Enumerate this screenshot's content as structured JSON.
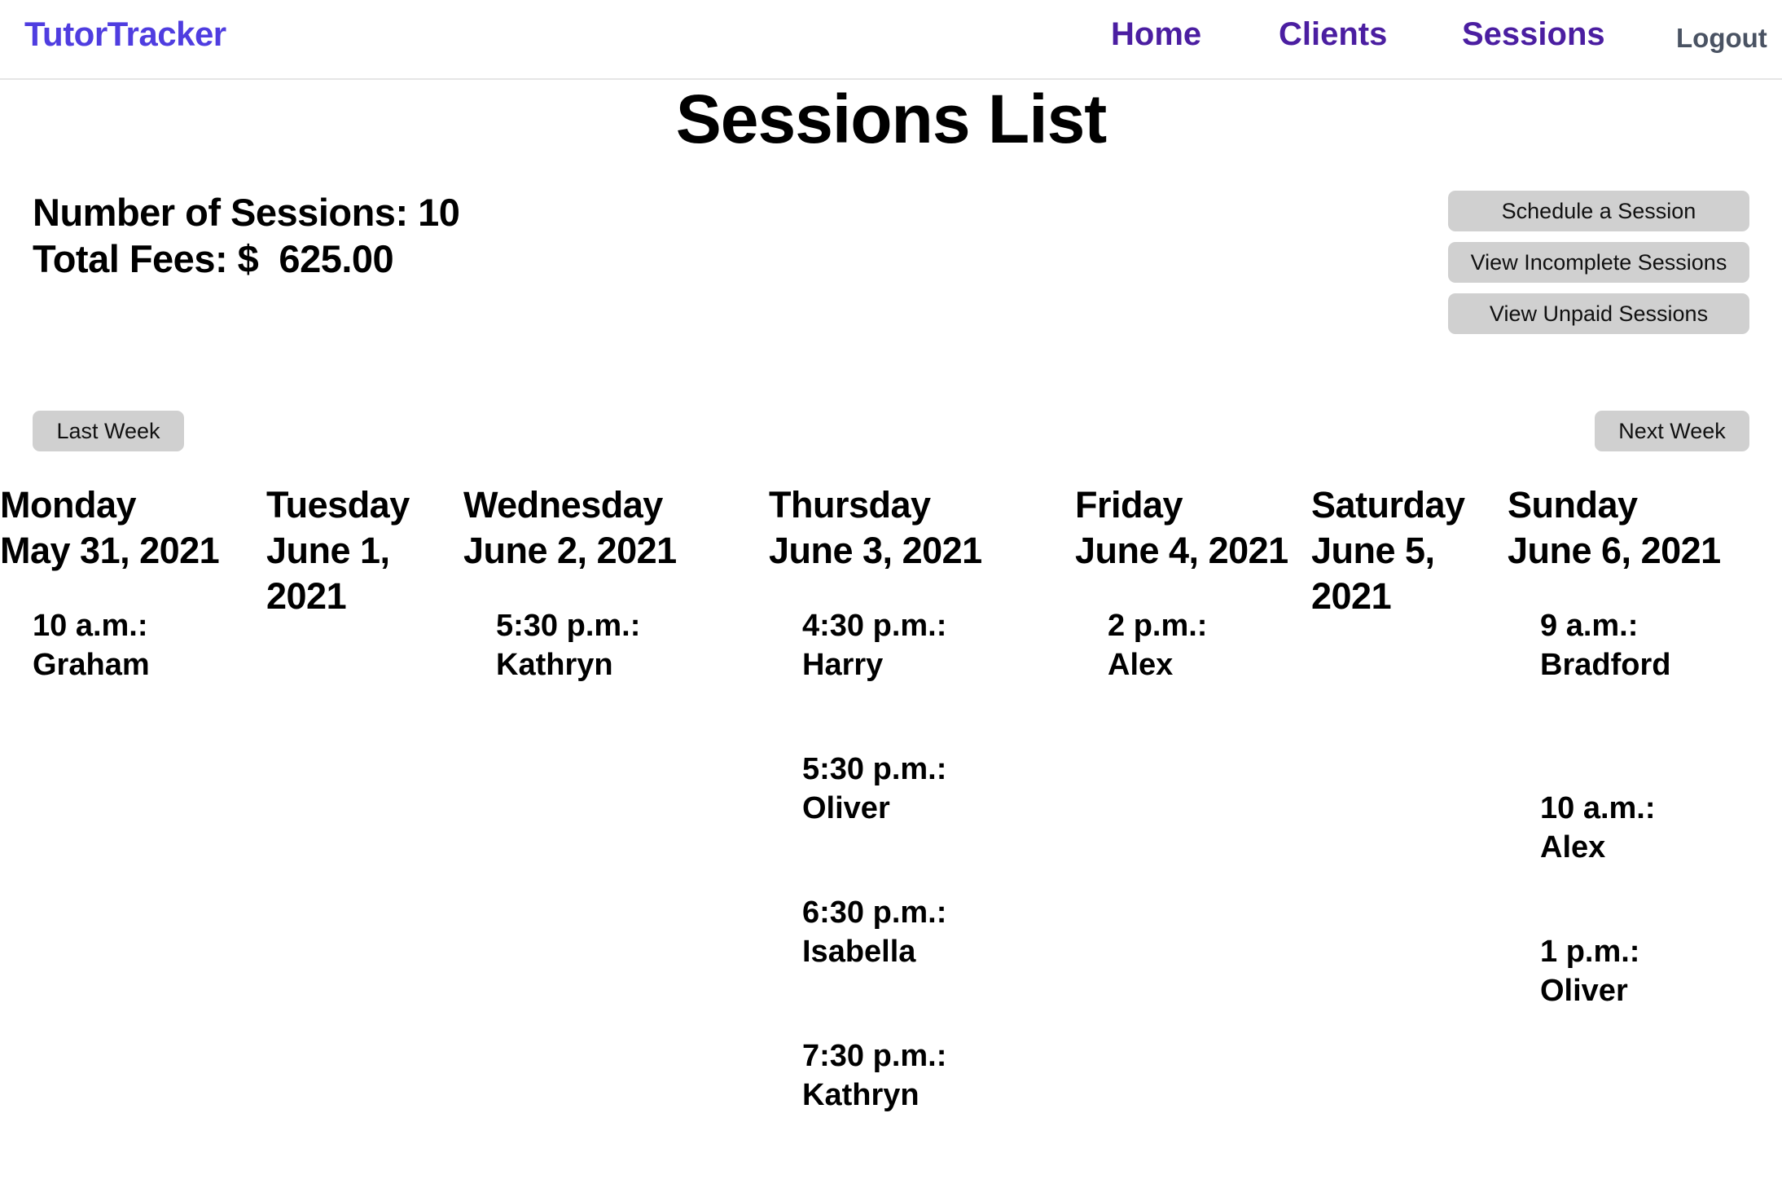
{
  "nav": {
    "brand": "TutorTracker",
    "home": "Home",
    "clients": "Clients",
    "sessions": "Sessions",
    "logout": "Logout"
  },
  "title": "Sessions List",
  "summary": {
    "count_line": "Number of Sessions: 10",
    "fees_line": "Total Fees: $  625.00"
  },
  "actions": {
    "schedule": "Schedule a Session",
    "incomplete": "View Incomplete Sessions",
    "unpaid": "View Unpaid Sessions"
  },
  "week_nav": {
    "last": "Last Week",
    "next": "Next Week"
  },
  "days": [
    {
      "name": "Monday",
      "date": "May 31, 2021",
      "sessions": [
        {
          "time": "10 a.m.:",
          "client": "Graham"
        }
      ]
    },
    {
      "name": "Tuesday",
      "date": "June 1, 2021",
      "sessions": []
    },
    {
      "name": "Wednesday",
      "date": "June 2, 2021",
      "sessions": [
        {
          "time": "5:30 p.m.:",
          "client": "Kathryn"
        }
      ]
    },
    {
      "name": "Thursday",
      "date": "June 3, 2021",
      "sessions": [
        {
          "time": "4:30 p.m.:",
          "client": "Harry"
        },
        {
          "time": "5:30 p.m.:",
          "client": "Oliver"
        },
        {
          "time": "6:30 p.m.:",
          "client": "Isabella"
        },
        {
          "time": "7:30 p.m.:",
          "client": "Kathryn"
        }
      ]
    },
    {
      "name": "Friday",
      "date": "June 4, 2021",
      "sessions": [
        {
          "time": "2 p.m.:",
          "client": "Alex"
        }
      ]
    },
    {
      "name": "Saturday",
      "date": "June 5, 2021",
      "sessions": []
    },
    {
      "name": "Sunday",
      "date": "June 6, 2021",
      "sessions": [
        {
          "time": "9 a.m.:",
          "client": "Bradford"
        },
        {
          "time": "10 a.m.:",
          "client": "Alex"
        },
        {
          "time": "1 p.m.:",
          "client": "Oliver"
        }
      ]
    }
  ]
}
